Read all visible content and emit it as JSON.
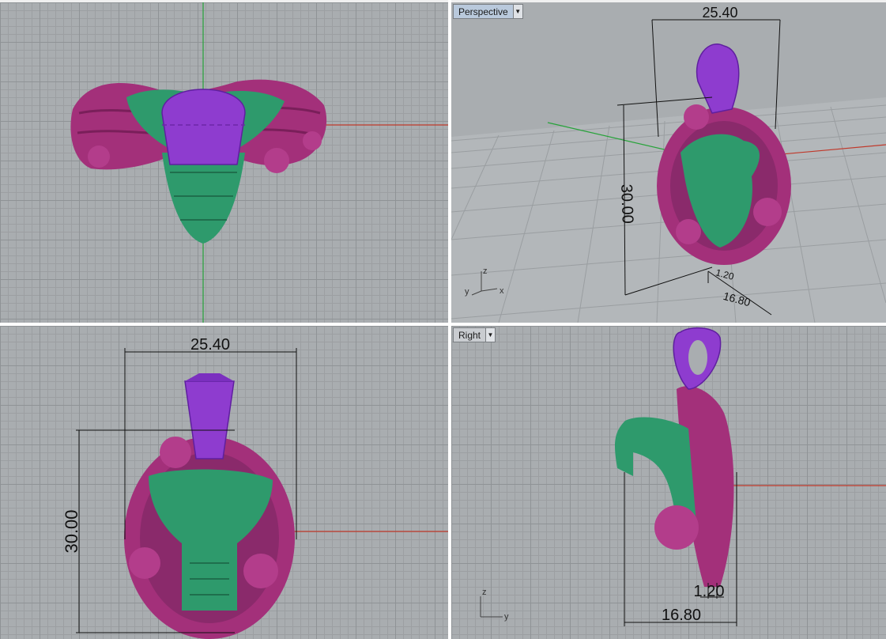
{
  "viewports": {
    "top": {
      "name": ""
    },
    "perspective": {
      "name": "Perspective",
      "dimensions": {
        "width": "25.40",
        "height": "30.00",
        "depth": "16.80",
        "thickness": "1.20"
      },
      "axes": {
        "x": "x",
        "y": "y",
        "z": "z"
      }
    },
    "front": {
      "name": "",
      "dimensions": {
        "width": "25.40",
        "height": "30.00"
      }
    },
    "right": {
      "name": "Right",
      "dimensions": {
        "depth": "16.80",
        "thickness": "1.20"
      },
      "axes": {
        "y": "y",
        "z": "z"
      }
    }
  },
  "colors": {
    "viewport_bg": "#a9adb0",
    "grid_major": "#8f9396",
    "grid_minor": "#9c9fa2",
    "snake_green": "#2e9a6c",
    "rose_magenta": "#a3307a",
    "bail_purple": "#8e3ccf",
    "axis_x": "#c0392b",
    "axis_y": "#27a33a",
    "active_tab": "#b9c9dc"
  }
}
